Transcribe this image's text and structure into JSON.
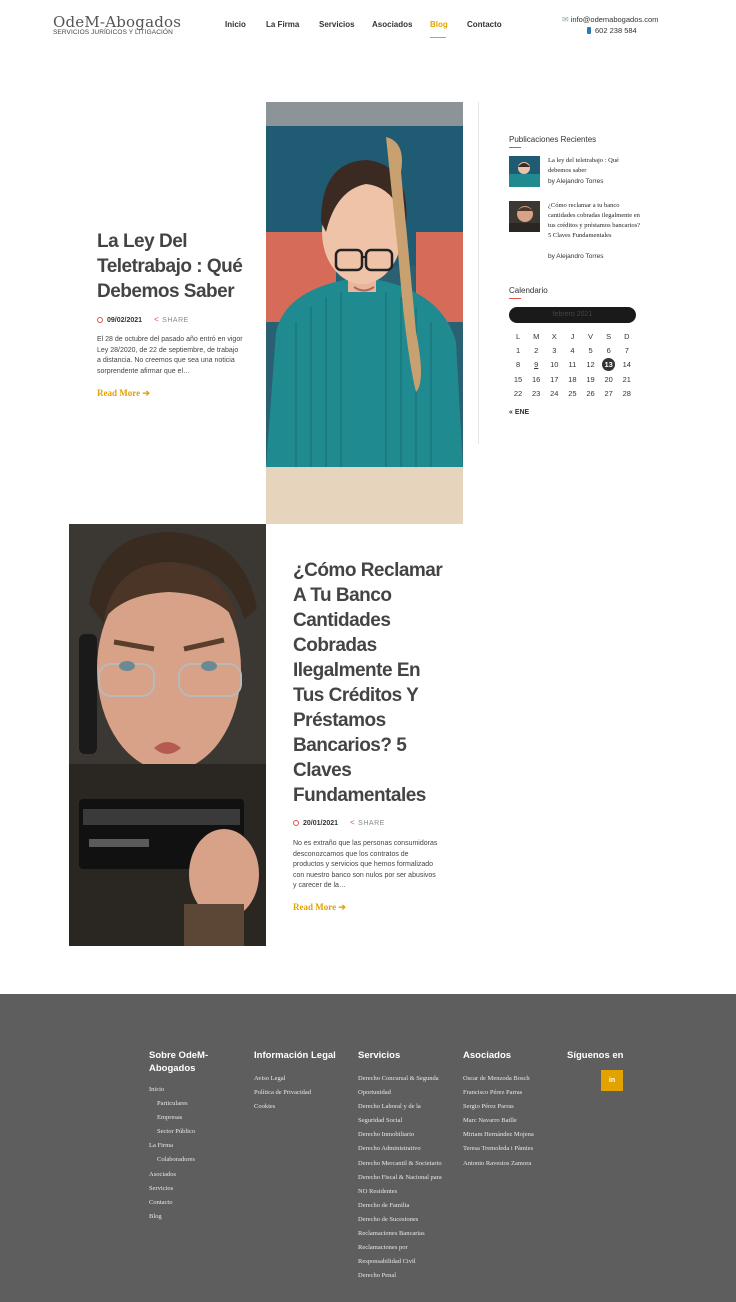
{
  "header": {
    "logo_title": "OdeM-Abogados",
    "logo_subtitle": "SERVICIOS JURÍDICOS Y LITIGACIÓN",
    "nav": [
      "Inicio",
      "La Firma",
      "Servicios",
      "Asociados",
      "Blog",
      "Contacto"
    ],
    "active_nav": "Blog",
    "email": "info@odemabogados.com",
    "phone": "602 238 584"
  },
  "posts": [
    {
      "title": "La Ley Del Teletrabajo : Qué Debemos Saber",
      "date": "09/02/2021",
      "share": "SHARE",
      "excerpt": "El 28 de octubre del pasado año entró en vigor Ley 28/2020, de 22 de septiembre, de trabajo a distancia. No creemos que sea una noticia sorprendente afirmar que el…",
      "read_more": "Read More"
    },
    {
      "title": "¿Cómo Reclamar A Tu Banco Cantidades Cobradas Ilegalmente En Tus Créditos Y Préstamos Bancarios? 5 Claves Fundamentales",
      "date": "20/01/2021",
      "share": "SHARE",
      "excerpt": "No es extraño que las personas consumidoras desconozcamos que los contratos de productos y servicios que hemos formalizado con nuestro banco son nulos por ser abusivos y carecer de la…",
      "read_more": "Read More"
    }
  ],
  "sidebar": {
    "recent_title": "Publicaciones Recientes",
    "recent": [
      {
        "title": "La ley del teletrabajo : Qué debemos saber",
        "author": "by Alejandro Torres"
      },
      {
        "title": "¿Cómo reclamar a tu banco cantidades cobradas ilegalmente en tus créditos y préstamos bancarios? 5 Claves Fundamentales",
        "author": "by Alejandro Torres"
      }
    ],
    "calendar_title": "Calendario",
    "calendar": {
      "month": "febrero 2021",
      "weekdays": [
        "L",
        "M",
        "X",
        "J",
        "V",
        "S",
        "D"
      ],
      "weeks": [
        [
          "1",
          "2",
          "3",
          "4",
          "5",
          "6",
          "7"
        ],
        [
          "8",
          "9",
          "10",
          "11",
          "12",
          "13",
          "14"
        ],
        [
          "15",
          "16",
          "17",
          "18",
          "19",
          "20",
          "21"
        ],
        [
          "22",
          "23",
          "24",
          "25",
          "26",
          "27",
          "28"
        ]
      ],
      "today": "13",
      "linked_day": "9",
      "prev": "« ENE"
    }
  },
  "footer": {
    "col1": {
      "title": "Sobre OdeM-Abogados",
      "items": [
        {
          "label": "Inicio",
          "sub": false
        },
        {
          "label": "Particulares",
          "sub": true
        },
        {
          "label": "Empresas",
          "sub": true
        },
        {
          "label": "Sector Público",
          "sub": true
        },
        {
          "label": "La Firma",
          "sub": false
        },
        {
          "label": "Colaboradores",
          "sub": true
        },
        {
          "label": "Asociados",
          "sub": false
        },
        {
          "label": "Servicios",
          "sub": false
        },
        {
          "label": "Contacto",
          "sub": false
        },
        {
          "label": "Blog",
          "sub": false
        }
      ]
    },
    "col2": {
      "title": "Información Legal",
      "items": [
        "Aviso Legal",
        "Política de Privacidad",
        "Cookies"
      ]
    },
    "col3": {
      "title": "Servicios",
      "items": [
        "Derecho Concursal & Segunda",
        "Oportunidad",
        "Derecho Laboral y de la",
        "Seguridad Social",
        "Derecho Inmobiliario",
        "Derecho Administrativo",
        "Derecho Mercantil & Societario",
        "Derecho Fiscal & Nacional para",
        "NO Residentes",
        "Derecho de Familia",
        "Derecho de Sucesiones",
        "Reclamaciones Bancarias",
        "Reclamaciones por",
        "Responsabilidad Civil",
        "Derecho Penal"
      ]
    },
    "col4": {
      "title": "Asociados",
      "items": [
        "Oscar de Menzoda Bosch",
        "Francisco Pérez Parras",
        "Sergio Pérez Parras",
        "Marc Navarro Batlle",
        "Miriam Hernández Mojena",
        "Teresa Tremoleda i Pàmies",
        "Antonio Ravestos Zamora"
      ]
    },
    "col5": {
      "title": "Síguenos en",
      "social": "in"
    }
  },
  "colors": {
    "accent": "#e2a300",
    "footer_bg": "#5e5e5e",
    "meta_icon": "#dd5544"
  }
}
